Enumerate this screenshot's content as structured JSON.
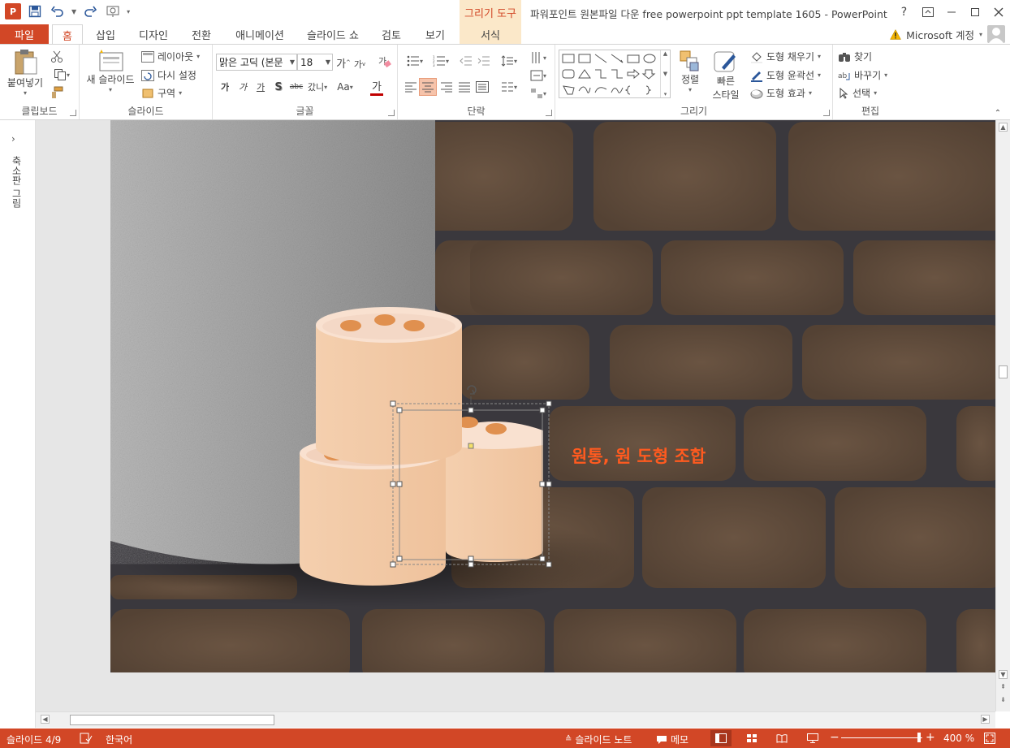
{
  "window": {
    "title": "파워포인트 원본파일 다운 free powerpoint ppt template 1605 - PowerPoint",
    "context_tab_group": "그리기 도구",
    "app_icon_letter": "P"
  },
  "tabs": {
    "file": "파일",
    "items": [
      "홈",
      "삽입",
      "디자인",
      "전환",
      "애니메이션",
      "슬라이드 쇼",
      "검토",
      "보기",
      "서식"
    ],
    "active": "홈"
  },
  "account": {
    "label": "Microsoft 계정"
  },
  "ribbon": {
    "clipboard": {
      "label": "클립보드",
      "paste": "붙여넣기"
    },
    "slides": {
      "label": "슬라이드",
      "new_slide": "새 슬라이드",
      "layout": "레이아웃",
      "reset": "다시 설정",
      "section": "구역"
    },
    "font": {
      "label": "글꼴",
      "font_name": "맑은 고딕 (본문",
      "font_size": "18",
      "grow": "가",
      "shrink": "가",
      "bold": "가",
      "italic": "가",
      "underline": "가",
      "shadow": "S",
      "strike": "abc",
      "spacing": "갔니",
      "case": "Aa",
      "color": "가"
    },
    "paragraph": {
      "label": "단락"
    },
    "drawing": {
      "label": "그리기",
      "arrange": "정렬",
      "quick_styles_1": "빠른",
      "quick_styles_2": "스타일",
      "fill": "도형 채우기",
      "outline": "도형 윤곽선",
      "effects": "도형 효과"
    },
    "editing": {
      "label": "편집",
      "find": "찾기",
      "replace": "바꾸기",
      "select": "선택"
    }
  },
  "left_pane": {
    "label": "축소판 그림"
  },
  "slide": {
    "caption": "원통, 원 도형 조합",
    "caption_color": "#ff5a1f",
    "brick_color": "#5e4a3c",
    "mortar_color": "#3d3a3f",
    "cylinder_body_color": "#f3cba8",
    "cylinder_top_color": "#f9e1d0",
    "dot_color": "#e0904f"
  },
  "status": {
    "slide_info": "슬라이드 4/9",
    "language": "한국어",
    "notes": "슬라이드 노트",
    "comments": "메모",
    "zoom": "400 %"
  }
}
